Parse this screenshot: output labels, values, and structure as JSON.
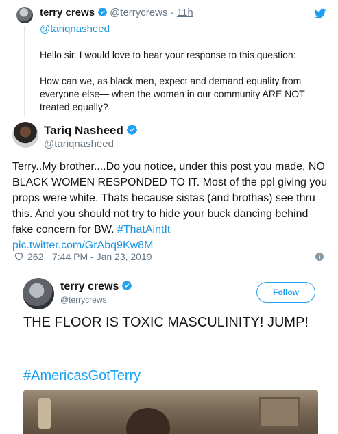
{
  "reply_tweet": {
    "author_name": "terry crews",
    "author_handle": "@terrycrews",
    "separator": "·",
    "time": "11h",
    "replying_to": "@tariqnasheed",
    "paragraphs": [
      "Hello sir.  I would love to hear your response to this question:",
      "How can we, as black men, expect and demand equality from everyone else— when the women in our community ARE NOT treated equally?"
    ],
    "icon": "twitter-bird-icon"
  },
  "main_tweet": {
    "author_name": "Tariq Nasheed",
    "author_handle": "@tariqnasheed",
    "text": "Terry..My brother....Do you notice, under this post you made, NO BLACK WOMEN RESPONDED TO IT. Most of the ppl giving you props were white. Thats because sistas (and brothas) see thru this. And you should not try to hide your buck dancing behind fake concern for BW. ",
    "hashtag": "#ThatAintIt",
    "pic_link": "pic.twitter.com/GrAbq9Kw8M",
    "likes": "262",
    "datetime": "7:44 PM - Jan 23, 2019",
    "info_icon": "i"
  },
  "embedded_tweet": {
    "author_name": "terry crews",
    "author_handle": "@terrycrews",
    "follow_label": "Follow",
    "text": "THE FLOOR IS TOXIC MASCULINITY! JUMP!",
    "hashtag": "#AmericasGotTerry"
  },
  "colors": {
    "link": "#1b95e0",
    "verified": "#1da1f2",
    "secondary_text": "#657786"
  }
}
